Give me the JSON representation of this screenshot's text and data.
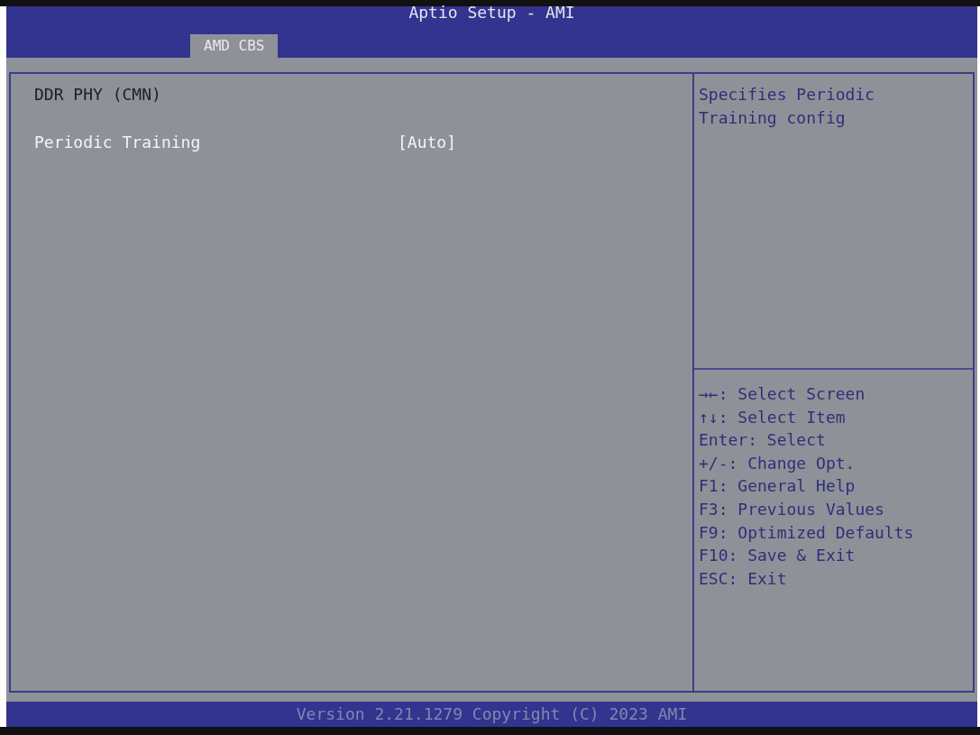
{
  "window": {
    "title": "Aptio Setup - AMI"
  },
  "tabs": [
    {
      "label": "AMD CBS",
      "selected": true
    }
  ],
  "items": [
    {
      "kind": "subtitle",
      "label": "DDR PHY (CMN)"
    },
    {
      "kind": "setting",
      "label": "Periodic Training",
      "value": "[Auto]",
      "selected": true
    }
  ],
  "help": {
    "description": "Specifies Periodic Training config",
    "keys": [
      "→←: Select Screen",
      "↑↓: Select Item",
      "Enter: Select",
      "+/-: Change Opt.",
      "F1: General Help",
      "F3: Previous Values",
      "F9: Optimized Defaults",
      "F10: Save & Exit",
      "ESC: Exit"
    ]
  },
  "status_bar": "Version 2.21.1279 Copyright (C) 2023 AMI"
}
